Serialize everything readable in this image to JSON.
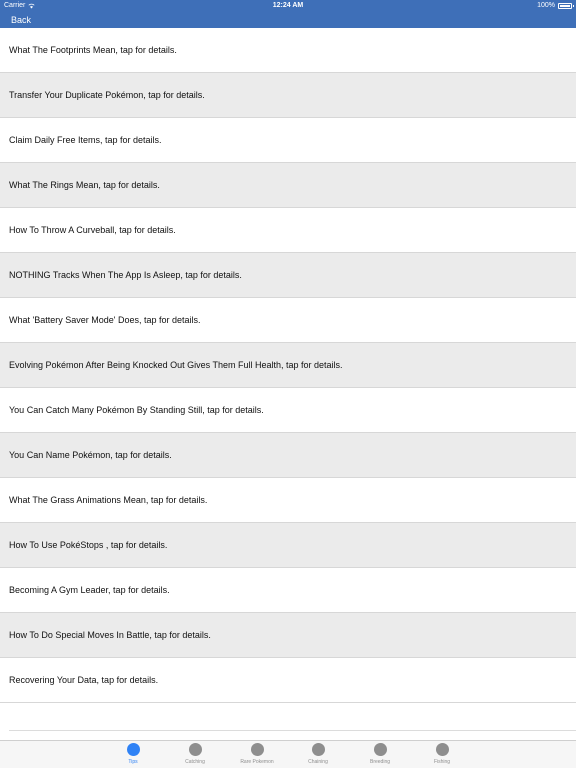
{
  "status_bar": {
    "carrier": "Carrier",
    "time": "12:24 AM",
    "battery": "100%",
    "battery_level": 1.0
  },
  "nav": {
    "back_label": "Back",
    "bar_color": "#3e6fb8"
  },
  "tips": [
    "What The Footprints Mean, tap for details.",
    "Transfer Your Duplicate Pokémon, tap for details.",
    "Claim Daily Free Items, tap for details.",
    "What The Rings Mean, tap for details.",
    "How To Throw A Curveball, tap for details.",
    "NOTHING Tracks When The App Is Asleep, tap for details.",
    "What 'Battery Saver Mode' Does, tap for details.",
    "Evolving Pokémon After Being Knocked Out Gives Them Full Health, tap for details.",
    "You Can Catch Many Pokémon By Standing Still, tap for details.",
    "You Can Name Pokémon, tap for details.",
    "What The Grass Animations Mean, tap for details.",
    "How To Use PokéStops , tap for details.",
    "Becoming A Gym Leader, tap for details.",
    "How To Do Special Moves In Battle, tap for details.",
    "Recovering Your Data, tap for details."
  ],
  "tabbar": {
    "active_color": "#2f82f5",
    "tabs": [
      {
        "label": "Tips",
        "icon": "tips-icon",
        "active": true
      },
      {
        "label": "Catching",
        "icon": "catching-icon",
        "active": false
      },
      {
        "label": "Rare Pokemon",
        "icon": "rare-pokemon-icon",
        "active": false
      },
      {
        "label": "Chaining",
        "icon": "chaining-icon",
        "active": false
      },
      {
        "label": "Breeding",
        "icon": "breeding-icon",
        "active": false
      },
      {
        "label": "Fishing",
        "icon": "fishing-icon",
        "active": false
      }
    ]
  }
}
